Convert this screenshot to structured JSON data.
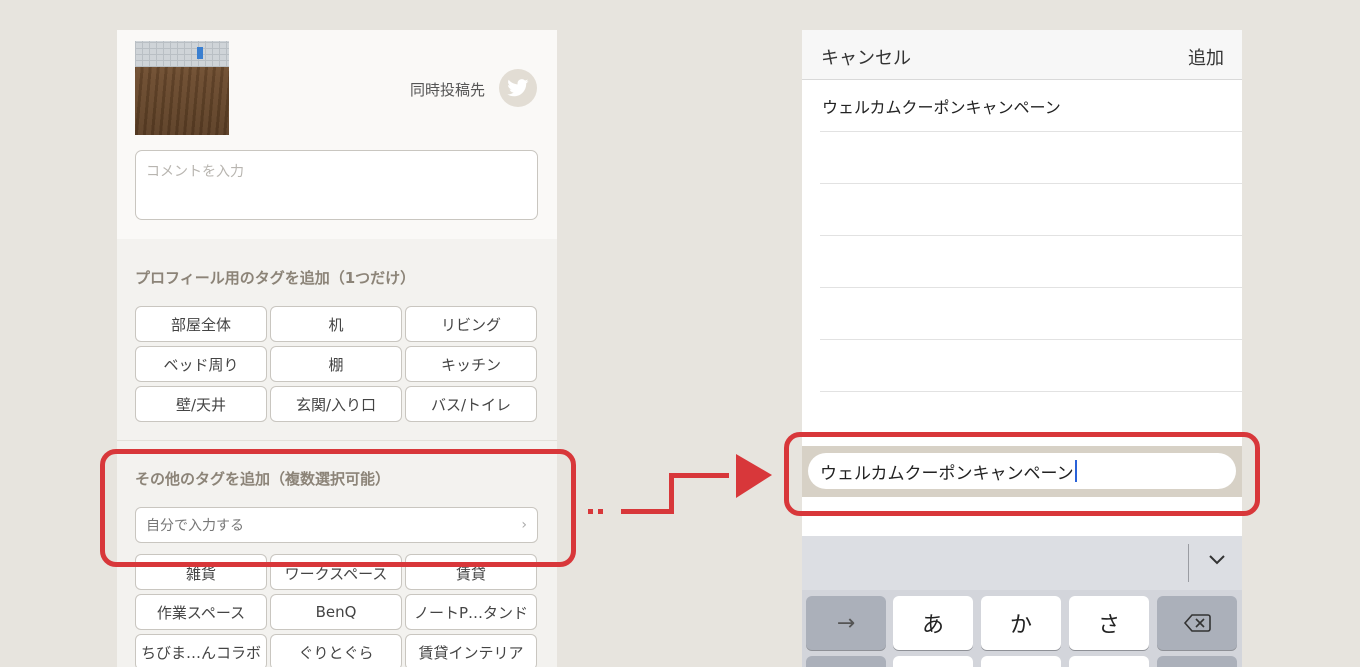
{
  "left_panel": {
    "simultaneous_post_label": "同時投稿先",
    "comment_placeholder": "コメントを入力",
    "profile_tags_title": "プロフィール用のタグを追加（1つだけ）",
    "profile_tags": [
      "部屋全体",
      "机",
      "リビング",
      "ベッド周り",
      "棚",
      "キッチン",
      "壁/天井",
      "玄関/入り口",
      "バス/トイレ"
    ],
    "other_tags_title": "その他のタグを追加（複数選択可能）",
    "self_input_label": "自分で入力する",
    "other_tags": [
      "雑貨",
      "ワークスペース",
      "賃貸",
      "作業スペース",
      "BenQ",
      "ノートP…タンド",
      "ちびま…んコラボ",
      "ぐりとぐら",
      "賃貸インテリア"
    ]
  },
  "right_panel": {
    "cancel_label": "キャンセル",
    "add_label": "追加",
    "list_items": [
      "ウェルカムクーポンキャンペーン",
      "",
      "",
      "",
      "",
      "",
      ""
    ],
    "input_value": "ウェルカムクーポンキャンペーン",
    "keyboard": {
      "keys": [
        "→",
        "あ",
        "か",
        "さ",
        "⌫"
      ]
    }
  },
  "colors": {
    "highlight_red": "#d8373a",
    "caret_blue": "#2a62d8"
  }
}
